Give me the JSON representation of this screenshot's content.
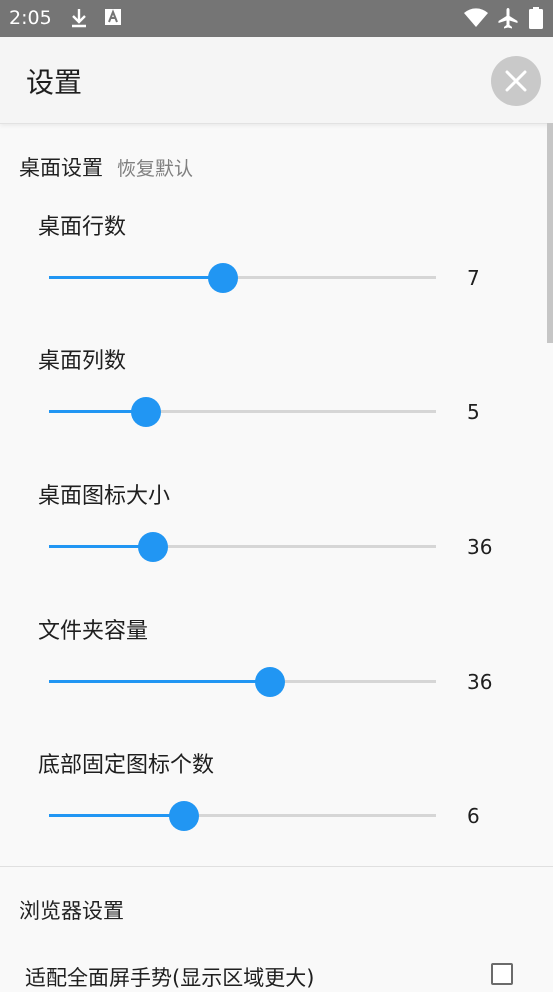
{
  "status_bar": {
    "time": "2:05",
    "icons": [
      "download-icon",
      "text-a-icon",
      "wifi-icon",
      "airplane-icon",
      "battery-icon"
    ]
  },
  "header": {
    "title": "设置",
    "close_icon": "close-icon"
  },
  "desktop_settings": {
    "title": "桌面设置",
    "reset_label": "恢复默认",
    "sliders": [
      {
        "label": "桌面行数",
        "value": "7",
        "fraction": 0.45
      },
      {
        "label": "桌面列数",
        "value": "5",
        "fraction": 0.25
      },
      {
        "label": "桌面图标大小",
        "value": "36",
        "fraction": 0.27
      },
      {
        "label": "文件夹容量",
        "value": "36",
        "fraction": 0.57
      },
      {
        "label": "底部固定图标个数",
        "value": "6",
        "fraction": 0.35
      }
    ]
  },
  "browser_settings": {
    "title": "浏览器设置",
    "checkbox_label": "适配全面屏手势(显示区域更大)",
    "checked": false
  },
  "colors": {
    "accent": "#2196f3",
    "status_bar": "#757575",
    "track": "#d6d6d6"
  }
}
